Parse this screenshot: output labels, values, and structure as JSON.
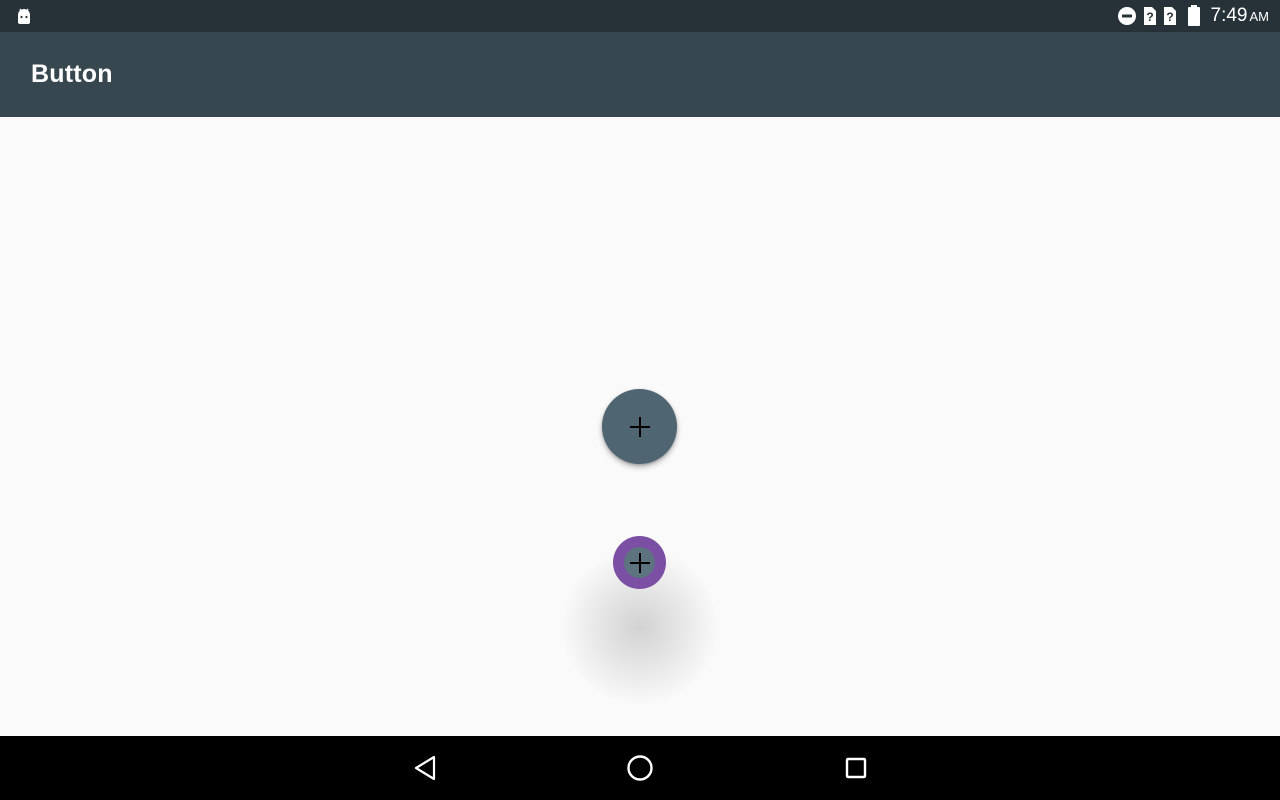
{
  "status_bar": {
    "time": "7:49",
    "ampm": "AM",
    "icons": [
      "android-icon",
      "do-not-disturb-icon",
      "sim-unknown-icon",
      "sim-unknown-icon",
      "battery-icon"
    ]
  },
  "app_bar": {
    "title": "Button"
  },
  "content": {
    "fab_main_icon": "add-icon",
    "fab_mini_icon": "add-icon",
    "fab_main_color": "#4f6572",
    "fab_mini_color": "#7b4fa3"
  },
  "nav_bar": {
    "buttons": [
      "back-icon",
      "home-icon",
      "recents-icon"
    ]
  },
  "colors": {
    "status_bar": "#263238",
    "app_bar": "#37474f",
    "background": "#fafafa"
  }
}
